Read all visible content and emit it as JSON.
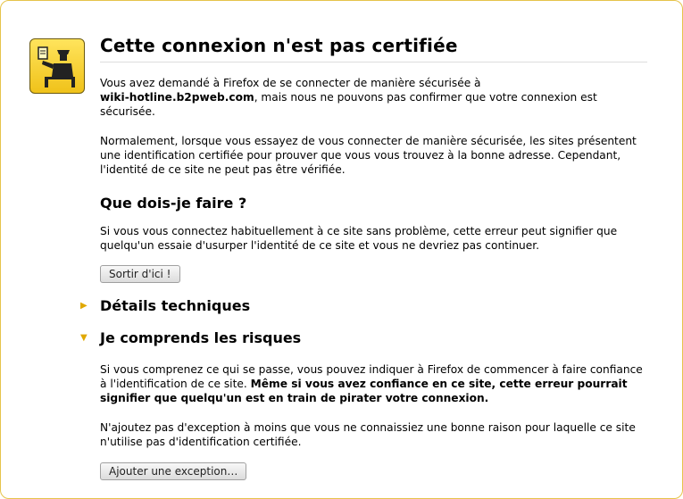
{
  "title": "Cette connexion n'est pas certifiée",
  "intro": {
    "before": "Vous avez demandé à Firefox de se connecter de manière sécurisée à",
    "host": "wiki-hotline.b2pweb.com",
    "after": ", mais nous ne pouvons pas confirmer que votre connexion est sécurisée."
  },
  "normally": "Normalement, lorsque vous essayez de vous connecter de manière sécurisée, les sites présentent une identification certifiée pour prouver que vous vous trouvez à la bonne adresse. Cependant, l'identité de ce site ne peut pas être vérifiée.",
  "what_heading": "Que dois-je faire ?",
  "what_text": "Si vous vous connectez habituellement à ce site sans problème, cette erreur peut signifier que quelqu'un essaie d'usurper l'identité de ce site et vous ne devriez pas continuer.",
  "get_out_button": "Sortir d'ici !",
  "technical_details": {
    "arrow": "▶",
    "label": "Détails techniques"
  },
  "risks": {
    "arrow": "▼",
    "label": "Je comprends les risques",
    "text_before": "Si vous comprenez ce qui se passe, vous pouvez indiquer à Firefox de commencer à faire confiance à l'identification de ce site. ",
    "text_bold": "Même si vous avez confiance en ce site, cette erreur pourrait signifier que quelqu'un est en train de pirater votre connexion.",
    "warning": "N'ajoutez pas d'exception à moins que vous ne connaissiez une bonne raison pour laquelle ce site n'utilise pas d'identification certifiée.",
    "add_exception_button": "Ajouter une exception…"
  },
  "colors": {
    "border": "#e6c44a",
    "icon_bg": "#f5cf2a",
    "arrow": "#e0a800"
  },
  "icon": "security-officer-icon"
}
